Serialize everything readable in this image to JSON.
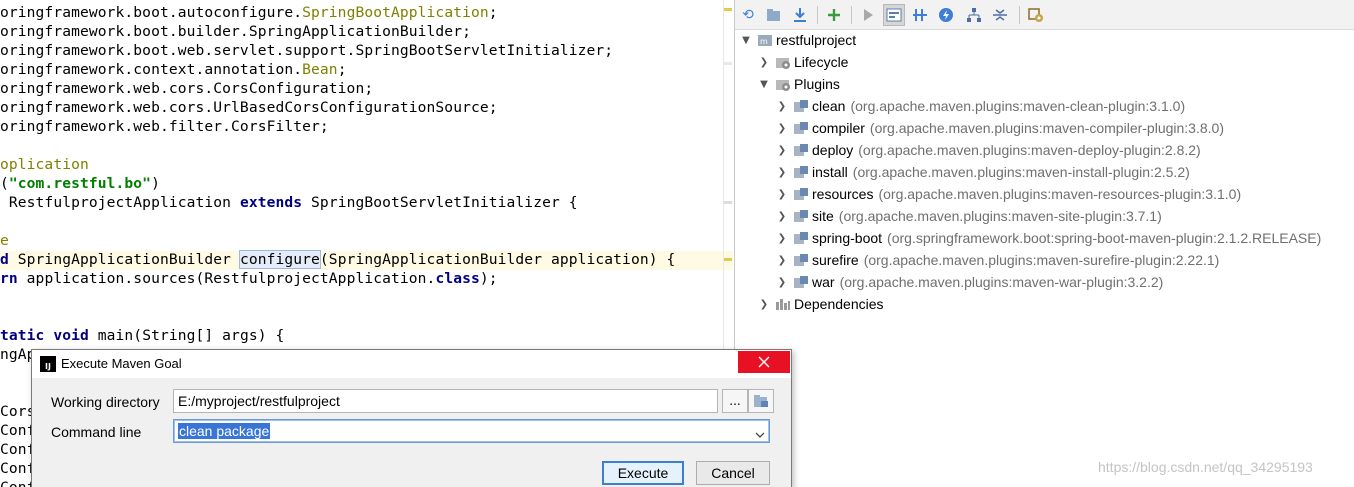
{
  "editor": {
    "lines": [
      {
        "parts": [
          [
            "",
            "oringframework.boot.autoconfigure."
          ],
          [
            "ann",
            "SpringBootApplication"
          ],
          [
            "",
            ";"
          ]
        ]
      },
      {
        "parts": [
          [
            "",
            "oringframework.boot.builder.SpringApplicationBuilder;"
          ]
        ]
      },
      {
        "parts": [
          [
            "",
            "oringframework.boot.web.servlet.support.SpringBootServletInitializer;"
          ]
        ]
      },
      {
        "parts": [
          [
            "",
            "oringframework.context.annotation."
          ],
          [
            "ann",
            "Bean"
          ],
          [
            "",
            ";"
          ]
        ]
      },
      {
        "parts": [
          [
            "",
            "oringframework.web.cors.CorsConfiguration;"
          ]
        ]
      },
      {
        "parts": [
          [
            "",
            "oringframework.web.cors.UrlBasedCorsConfigurationSource;"
          ]
        ]
      },
      {
        "parts": [
          [
            "",
            "oringframework.web.filter.CorsFilter;"
          ]
        ]
      },
      {
        "parts": []
      },
      {
        "parts": [
          [
            "ann",
            "oplication"
          ]
        ]
      },
      {
        "parts": [
          [
            "",
            "("
          ],
          [
            "str",
            "\"com.restful.bo\""
          ],
          [
            "",
            ")"
          ]
        ]
      },
      {
        "parts": [
          [
            "",
            " RestfulprojectApplication "
          ],
          [
            "kw",
            "extends"
          ],
          [
            "",
            " SpringBootServletInitializer {"
          ]
        ]
      },
      {
        "parts": []
      },
      {
        "parts": [
          [
            "ann",
            "e"
          ]
        ]
      },
      {
        "parts": [
          [
            "kw",
            "d"
          ],
          [
            "",
            " SpringApplicationBuilder "
          ],
          [
            "ident",
            "configure"
          ],
          [
            "",
            "(SpringApplicationBuilder application) {"
          ]
        ]
      },
      {
        "parts": [
          [
            "kw",
            "rn"
          ],
          [
            "",
            " application.sources(RestfulprojectApplication."
          ],
          [
            "kw",
            "class"
          ],
          [
            "",
            ");"
          ]
        ]
      },
      {
        "parts": []
      },
      {
        "parts": []
      },
      {
        "parts": [
          [
            "kw",
            "tatic void"
          ],
          [
            "",
            " main(String[] args) {"
          ]
        ]
      },
      {
        "parts": [
          [
            "",
            "ngAp"
          ]
        ]
      },
      {
        "parts": []
      },
      {
        "parts": []
      },
      {
        "parts": [
          [
            "",
            "Cors"
          ]
        ]
      },
      {
        "parts": [
          [
            "",
            "Conf"
          ]
        ]
      },
      {
        "parts": [
          [
            "",
            "Conf"
          ]
        ]
      },
      {
        "parts": [
          [
            "",
            "Conf"
          ]
        ]
      },
      {
        "parts": [
          [
            "",
            "Conf"
          ]
        ]
      }
    ]
  },
  "maven": {
    "toolbar_icons": [
      "refresh-icon",
      "reimport-folder-icon",
      "download-icon",
      "add-icon",
      "run-icon",
      "execute-goal-icon",
      "toggle-offline-icon",
      "skip-tests-icon",
      "show-dependencies-icon",
      "collapse-all-icon",
      "settings-icon"
    ],
    "tree": {
      "root": "restfulproject",
      "lifecycle": "Lifecycle",
      "plugins_label": "Plugins",
      "plugins": [
        {
          "name": "clean",
          "coord": "(org.apache.maven.plugins:maven-clean-plugin:3.1.0)"
        },
        {
          "name": "compiler",
          "coord": "(org.apache.maven.plugins:maven-compiler-plugin:3.8.0)"
        },
        {
          "name": "deploy",
          "coord": "(org.apache.maven.plugins:maven-deploy-plugin:2.8.2)"
        },
        {
          "name": "install",
          "coord": "(org.apache.maven.plugins:maven-install-plugin:2.5.2)"
        },
        {
          "name": "resources",
          "coord": "(org.apache.maven.plugins:maven-resources-plugin:3.1.0)"
        },
        {
          "name": "site",
          "coord": "(org.apache.maven.plugins:maven-site-plugin:3.7.1)"
        },
        {
          "name": "spring-boot",
          "coord": "(org.springframework.boot:spring-boot-maven-plugin:2.1.2.RELEASE)"
        },
        {
          "name": "surefire",
          "coord": "(org.apache.maven.plugins:maven-surefire-plugin:2.22.1)"
        },
        {
          "name": "war",
          "coord": "(org.apache.maven.plugins:maven-war-plugin:3.2.2)"
        }
      ],
      "dependencies": "Dependencies"
    }
  },
  "dialog": {
    "title": "Execute Maven Goal",
    "working_dir_label": "Working directory",
    "working_dir_value": "E:/myproject/restfulproject",
    "browse_label": "...",
    "command_label": "Command line",
    "command_value": "clean package",
    "execute_label": "Execute",
    "cancel_label": "Cancel"
  },
  "watermark": "https://blog.csdn.net/qq_34295193"
}
